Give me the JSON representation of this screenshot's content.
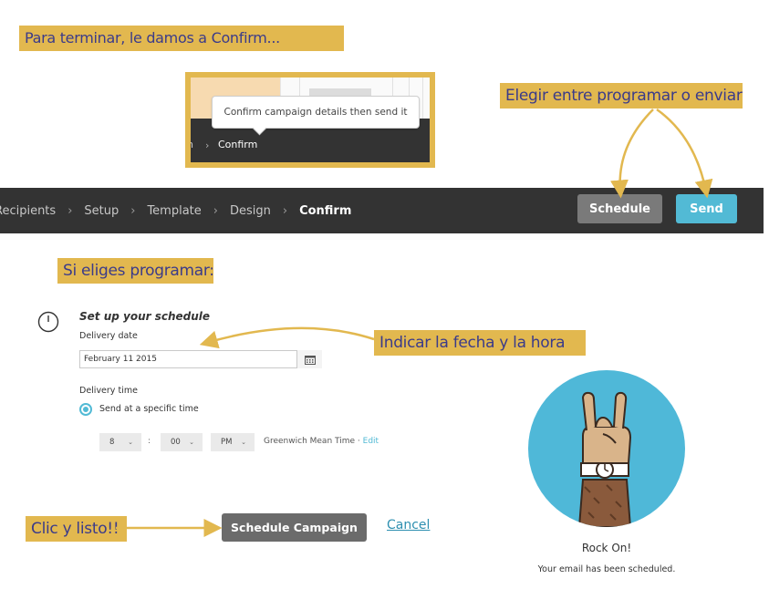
{
  "annotations": {
    "step_confirm": "Para terminar, le damos a Confirm...",
    "choose": "Elegir entre programar o enviar",
    "if_schedule": "Si eliges programar:",
    "date_time": "Indicar la fecha y la hora",
    "click_done": "Clic y listo!!"
  },
  "mini_screenshot": {
    "tooltip": "Confirm campaign details then send it",
    "crumb_partial": "n",
    "crumb_confirm": "Confirm"
  },
  "navbar": {
    "crumbs": [
      "Recipients",
      "Setup",
      "Template",
      "Design",
      "Confirm"
    ],
    "active_crumb": "Confirm",
    "schedule_label": "Schedule",
    "send_label": "Send"
  },
  "schedule_form": {
    "title": "Set up your schedule",
    "delivery_date_label": "Delivery date",
    "delivery_date_value": "February 11 2015",
    "delivery_time_label": "Delivery time",
    "radio_label": "Send at a specific time",
    "hour": "8",
    "minute": "00",
    "ampm": "PM",
    "colon": ":",
    "timezone": "Greenwich Mean Time",
    "edit_link": "Edit",
    "submit_label": "Schedule Campaign",
    "cancel_label": "Cancel"
  },
  "confirmation": {
    "title": "Rock On!",
    "message": "Your email has been scheduled."
  },
  "colors": {
    "note_bg": "#e2b84f",
    "note_text": "#3b3b8a",
    "navbar_bg": "#333333",
    "send_blue": "#52bad5",
    "schedule_gray": "#7a7a7a"
  }
}
